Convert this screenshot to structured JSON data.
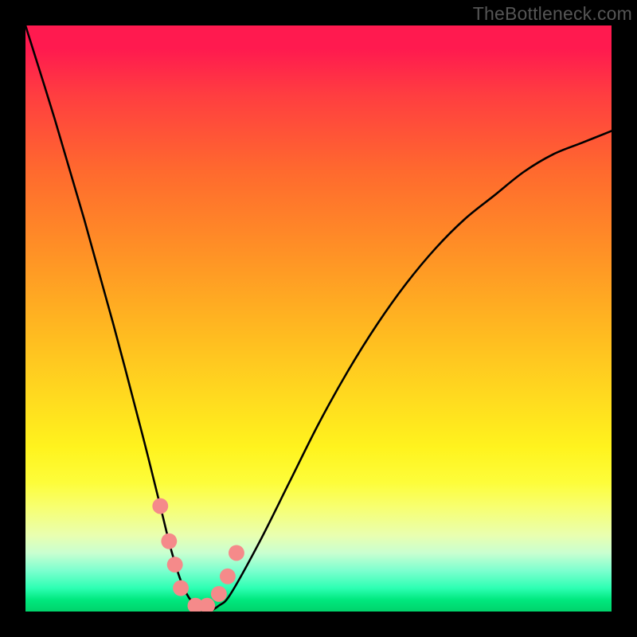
{
  "watermark": "TheBottleneck.com",
  "chart_data": {
    "type": "line",
    "title": "",
    "xlabel": "",
    "ylabel": "",
    "xlim": [
      0,
      100
    ],
    "ylim": [
      0,
      100
    ],
    "series": [
      {
        "name": "bottleneck-curve",
        "x": [
          0,
          5,
          10,
          15,
          20,
          23,
          25,
          27,
          29,
          31,
          33,
          35,
          40,
          45,
          50,
          55,
          60,
          65,
          70,
          75,
          80,
          85,
          90,
          95,
          100
        ],
        "y": [
          100,
          84,
          67,
          49,
          30,
          18,
          10,
          4,
          1,
          0,
          1,
          3,
          12,
          22,
          32,
          41,
          49,
          56,
          62,
          67,
          71,
          75,
          78,
          80,
          82
        ]
      }
    ],
    "markers": {
      "name": "red-dots",
      "points": [
        {
          "x": 23.0,
          "y": 18
        },
        {
          "x": 24.5,
          "y": 12
        },
        {
          "x": 25.5,
          "y": 8
        },
        {
          "x": 26.5,
          "y": 4
        },
        {
          "x": 29.0,
          "y": 1
        },
        {
          "x": 31.0,
          "y": 1
        },
        {
          "x": 33.0,
          "y": 3
        },
        {
          "x": 34.5,
          "y": 6
        },
        {
          "x": 36.0,
          "y": 10
        }
      ]
    },
    "background_gradient": {
      "top": "#ff1a4f",
      "bottom": "#00d36b"
    }
  }
}
